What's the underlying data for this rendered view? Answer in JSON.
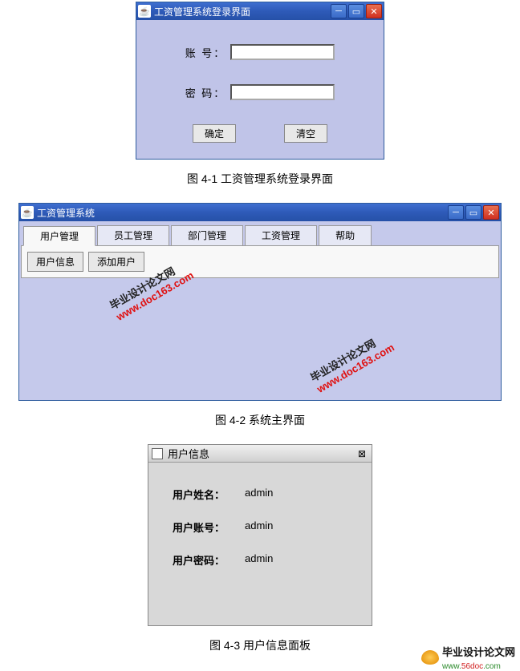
{
  "login": {
    "title": "工资管理系统登录界面",
    "account_label": "账  号：",
    "password_label": "密  码：",
    "account_value": "",
    "password_value": "",
    "ok_label": "确定",
    "clear_label": "清空"
  },
  "caption1": "图 4-1 工资管理系统登录界面",
  "main": {
    "title": "工资管理系统",
    "tabs": [
      "用户管理",
      "员工管理",
      "部门管理",
      "工资管理",
      "帮助"
    ],
    "sub_buttons": [
      "用户信息",
      "添加用户"
    ]
  },
  "caption2": "图 4-2 系统主界面",
  "userinfo": {
    "title": "用户信息",
    "name_label": "用户姓名：",
    "name_value": "admin",
    "account_label": "用户账号：",
    "account_value": "admin",
    "password_label": "用户密码：",
    "password_value": "admin"
  },
  "caption3": "图 4-3 用户信息面板",
  "watermark": {
    "cn": "毕业设计论文网",
    "url": "www.doc163.com"
  },
  "footer": {
    "brand": "毕业设计论文网",
    "domain_pre": "www.",
    "domain_mid": "56doc",
    "domain_suf": ".com"
  }
}
